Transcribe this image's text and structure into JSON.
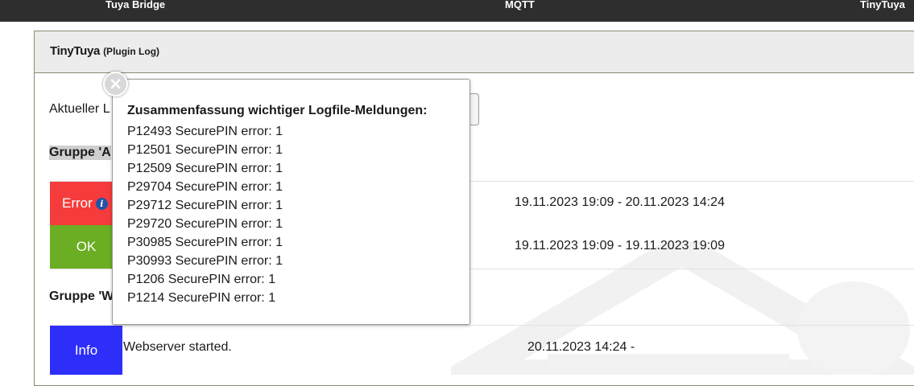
{
  "nav": {
    "items": [
      "Tuya Bridge",
      "MQTT",
      "TinyTuya"
    ]
  },
  "panel": {
    "title": "TinyTuya",
    "subtitle": "(Plugin Log)",
    "current_log_label": "Aktueller L",
    "group_a_label": "Gruppe 'A",
    "group_w_label": "Gruppe 'W",
    "rows": [
      {
        "status": "Error",
        "status_color": "#f53b3b",
        "message": "",
        "range": "19.11.2023 19:09 - 20.11.2023 14:24"
      },
      {
        "status": "OK",
        "status_color": "#6bad23",
        "message": "",
        "range": "19.11.2023 19:09 - 19.11.2023 19:09"
      },
      {
        "status": "Info",
        "status_color": "#2e2efa",
        "message": "Webserver started.",
        "range": "20.11.2023 14:24 -"
      }
    ],
    "info_icon": "info-icon"
  },
  "popup": {
    "title": "Zusammenfassung wichtiger Logfile-Meldungen:",
    "lines": [
      "P12493 SecurePIN error: 1",
      "P12501 SecurePIN error: 1",
      "P12509 SecurePIN error: 1",
      "P29704 SecurePIN error: 1",
      "P29712 SecurePIN error: 1",
      "P29720 SecurePIN error: 1",
      "P30985 SecurePIN error: 1",
      "P30993 SecurePIN error: 1",
      "P1206 SecurePIN error: 1",
      "P1214 SecurePIN error: 1"
    ],
    "close_icon": "close-icon"
  }
}
